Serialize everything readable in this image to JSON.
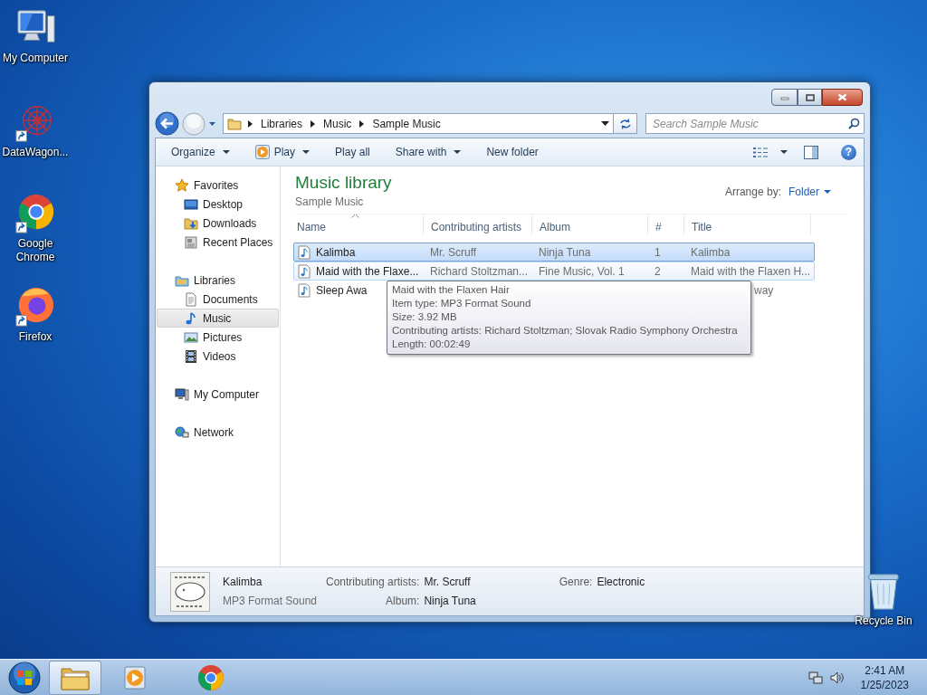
{
  "desktop": {
    "icons": [
      {
        "label": "My Computer"
      },
      {
        "label": "DataWagon..."
      },
      {
        "label": "Google Chrome"
      },
      {
        "label": "Firefox"
      },
      {
        "label": "Recycle Bin"
      }
    ]
  },
  "window": {
    "address": [
      "Libraries",
      "Music",
      "Sample Music"
    ],
    "search_placeholder": "Search Sample Music",
    "toolbar": [
      {
        "label": "Organize",
        "dropdown": true
      },
      {
        "label": "Play",
        "dropdown": true
      },
      {
        "label": "Play all",
        "dropdown": false
      },
      {
        "label": "Share with",
        "dropdown": true
      },
      {
        "label": "New folder",
        "dropdown": false
      }
    ],
    "help": "?",
    "nav": [
      {
        "label": "Favorites",
        "selected": false,
        "children": [
          {
            "label": "Desktop",
            "selected": false
          },
          {
            "label": "Downloads",
            "selected": false
          },
          {
            "label": "Recent Places",
            "selected": false
          }
        ]
      },
      {
        "label": "Libraries",
        "selected": false,
        "children": [
          {
            "label": "Documents",
            "selected": false
          },
          {
            "label": "Music",
            "selected": true
          },
          {
            "label": "Pictures",
            "selected": false
          },
          {
            "label": "Videos",
            "selected": false
          }
        ]
      },
      {
        "label": "My Computer",
        "selected": false
      },
      {
        "label": "Network",
        "selected": false
      }
    ],
    "library": {
      "title": "Music library",
      "subtitle": "Sample Music",
      "arrange_label": "Arrange by:",
      "arrange_value": "Folder"
    },
    "columns": [
      "Name",
      "Contributing artists",
      "Album",
      "#",
      "Title"
    ],
    "rows": [
      {
        "name": "Kalimba",
        "artists": "Mr. Scruff",
        "album": "Ninja Tuna",
        "number": "1",
        "title": "Kalimba",
        "selected": true,
        "hovered": false,
        "covered": false
      },
      {
        "name": "Maid with the Flaxe...",
        "artists": "Richard Stoltzman...",
        "album": "Fine Music, Vol. 1",
        "number": "2",
        "title": "Maid with the Flaxen H...",
        "selected": false,
        "hovered": true,
        "covered": false
      },
      {
        "name": "Sleep Awa",
        "title": "way",
        "selected": false,
        "hovered": false,
        "covered": true
      }
    ],
    "tooltip": [
      "Maid with the Flaxen Hair",
      "Item type: MP3 Format Sound",
      "Size: 3.92 MB",
      "Contributing artists: Richard Stoltzman; Slovak Radio Symphony Orchestra",
      "Length: 00:02:49"
    ],
    "details": {
      "title": "Kalimba",
      "type": "MP3 Format Sound",
      "field_columns": [
        [
          {
            "label": "Contributing artists:",
            "value": "Mr. Scruff"
          },
          {
            "label": "Album:",
            "value": "Ninja Tuna"
          }
        ],
        [
          {
            "label": "Genre:",
            "value": "Electronic"
          }
        ]
      ]
    }
  },
  "taskbar": {
    "apps": [
      {
        "selected": true
      },
      {
        "selected": false
      },
      {
        "selected": false
      }
    ],
    "time": "2:41 AM",
    "date": "1/25/2023"
  }
}
